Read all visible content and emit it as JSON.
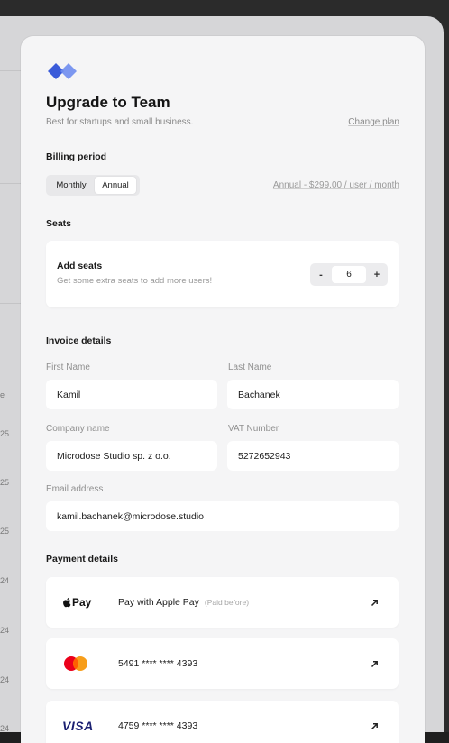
{
  "modal": {
    "title": "Upgrade to Team",
    "subtitle": "Best for startups and small business.",
    "change_plan": "Change plan"
  },
  "billing": {
    "label": "Billing period",
    "options": [
      "Monthly",
      "Annual"
    ],
    "selected": "Annual",
    "price_note": "Annual - $299.00 / user / month"
  },
  "seats": {
    "label": "Seats",
    "card_title": "Add seats",
    "card_subtitle": "Get some extra seats to add more users!",
    "minus": "-",
    "value": "6",
    "plus": "+"
  },
  "invoice": {
    "label": "Invoice details",
    "first_name_label": "First Name",
    "first_name_value": "Kamil",
    "last_name_label": "Last Name",
    "last_name_value": "Bachanek",
    "company_label": "Company name",
    "company_value": "Microdose Studio sp. z o.o.",
    "vat_label": "VAT Number",
    "vat_value": "5272652943",
    "email_label": "Email address",
    "email_value": "kamil.bachanek@microdose.studio"
  },
  "payment": {
    "label": "Payment details",
    "methods": [
      {
        "logo": "Pay",
        "text": "Pay with Apple Pay",
        "note": "(Paid before)",
        "icon": "arrow-up-right-icon"
      },
      {
        "logo": "mastercard",
        "text": "5491 **** **** 4393",
        "icon": "arrow-up-right-icon"
      },
      {
        "logo": "VISA",
        "text": "4759 **** **** 4393",
        "icon": "arrow-up-right-icon"
      }
    ]
  },
  "background": {
    "row_texts": [
      "e",
      "25",
      "25",
      "25",
      "24",
      "24",
      "24",
      "24"
    ]
  },
  "colors": {
    "modal_bg": "#f5f5f6",
    "logo_blue": "#3a5bd9",
    "mastercard_red": "#eb001b",
    "mastercard_orange": "#f79e1b",
    "visa_blue": "#1a1f71"
  }
}
